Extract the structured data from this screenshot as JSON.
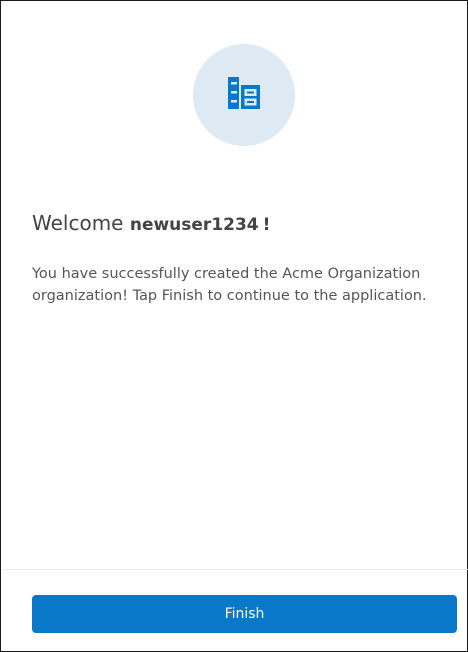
{
  "hero": {
    "icon": "building-icon",
    "icon_color": "#0a78c8",
    "circle_color": "#dde9f3"
  },
  "welcome": {
    "prefix": "Welcome",
    "username": "newuser1234",
    "suffix": "!"
  },
  "message": "You have successfully created the Acme Organization organization! Tap Finish to continue to the application.",
  "footer": {
    "finish_label": "Finish",
    "button_color": "#0a78c8"
  }
}
